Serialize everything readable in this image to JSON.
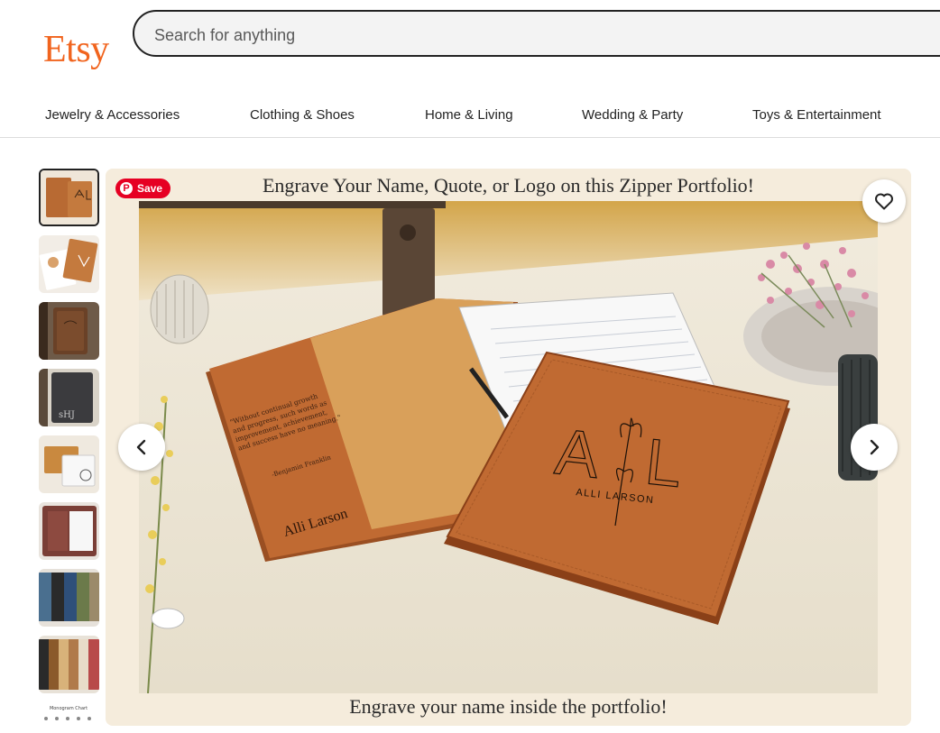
{
  "header": {
    "logo": "Etsy",
    "search_placeholder": "Search for anything"
  },
  "categories": [
    "Jewelry & Accessories",
    "Clothing & Shoes",
    "Home & Living",
    "Wedding & Party",
    "Toys & Entertainment"
  ],
  "gallery": {
    "caption_top": "Engrave Your Name, Quote, or Logo on this Zipper Portfolio!",
    "caption_bottom": "Engrave your name inside the portfolio!",
    "save_label": "Save",
    "inner_quote": "\"Without continual growth and progress, such words as improvement, achievement, and success have no meaning.\"",
    "inner_quote_author": "-Benjamin Franklin",
    "inner_name": "Alli Larson",
    "cover_monogram_left": "A",
    "cover_monogram_right": "L",
    "cover_name": "ALLI  LARSON",
    "thumbnail_count": 9,
    "thumbnail_text_1": "sHJ",
    "thumbnail_text_2": "Monogram Chart"
  },
  "colors": {
    "brand": "#f1641e",
    "pinterest": "#e60023",
    "leather": "#c06a32",
    "gallery_bg": "#f5ecdc"
  }
}
